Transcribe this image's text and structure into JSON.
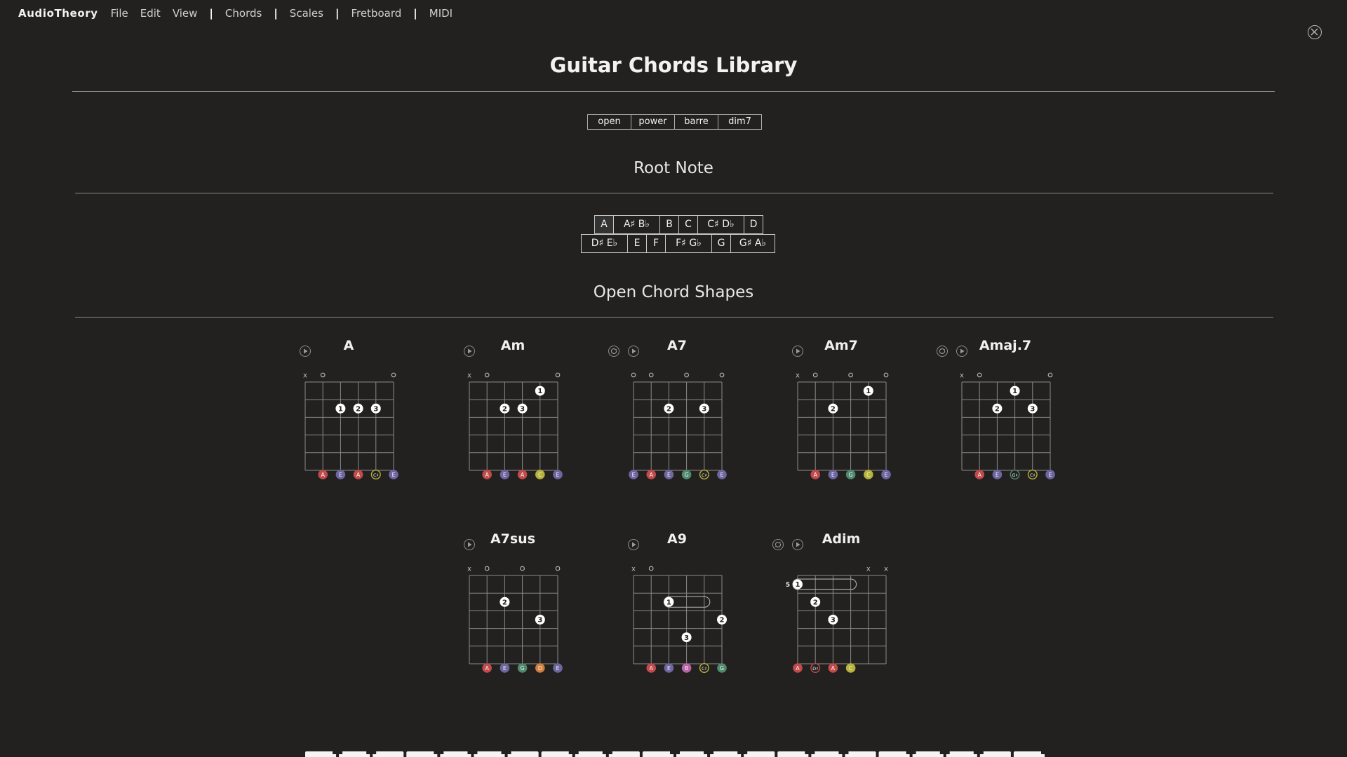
{
  "app": {
    "brand": "AudioTheory",
    "menu": [
      {
        "label": "File",
        "sepBefore": false
      },
      {
        "label": "Edit",
        "sepBefore": false
      },
      {
        "label": "View",
        "sepBefore": false
      },
      {
        "label": "Chords",
        "sepBefore": true
      },
      {
        "label": "Scales",
        "sepBefore": true
      },
      {
        "label": "Fretboard",
        "sepBefore": true
      },
      {
        "label": "MIDI",
        "sepBefore": true
      }
    ]
  },
  "page": {
    "title": "Guitar Chords Library"
  },
  "tabs": [
    {
      "label": "open",
      "active": true
    },
    {
      "label": "power",
      "active": false
    },
    {
      "label": "barre",
      "active": false
    },
    {
      "label": "dim7",
      "active": false
    }
  ],
  "root_note": {
    "heading": "Root Note",
    "row1": [
      "A",
      "A♯ B♭",
      "B",
      "C",
      "C♯ D♭",
      "D"
    ],
    "row2": [
      "D♯ E♭",
      "E",
      "F",
      "F♯ G♭",
      "G",
      "G♯ A♭"
    ]
  },
  "shapes": {
    "heading": "Open Chord Shapes"
  },
  "colors": {
    "A": "#c24a4a",
    "E": "#6e66a0",
    "G": "#4f8a6e",
    "C": "#b6b23a",
    "D": "#d27e3c",
    "B": "#b864a6",
    "background": "#222120",
    "grid": "#8a8a8a"
  },
  "chords": [
    {
      "name": "A",
      "hasLoop": false,
      "markers": [
        "x",
        "o",
        "",
        "",
        "",
        "o"
      ],
      "dots": [
        {
          "s": 2,
          "f": 2,
          "n": "1"
        },
        {
          "s": 3,
          "f": 2,
          "n": "2"
        },
        {
          "s": 4,
          "f": 2,
          "n": "3"
        }
      ],
      "notes": [
        null,
        {
          "t": "A",
          "c": "A"
        },
        {
          "t": "E",
          "c": "E"
        },
        {
          "t": "A",
          "c": "A"
        },
        {
          "t": "C♯",
          "c": "C",
          "o": true
        },
        {
          "t": "E",
          "c": "E"
        }
      ]
    },
    {
      "name": "Am",
      "hasLoop": false,
      "markers": [
        "x",
        "o",
        "",
        "",
        "",
        "o"
      ],
      "dots": [
        {
          "s": 2,
          "f": 2,
          "n": "2"
        },
        {
          "s": 3,
          "f": 2,
          "n": "3"
        },
        {
          "s": 4,
          "f": 1,
          "n": "1"
        }
      ],
      "notes": [
        null,
        {
          "t": "A",
          "c": "A"
        },
        {
          "t": "E",
          "c": "E"
        },
        {
          "t": "A",
          "c": "A"
        },
        {
          "t": "C",
          "c": "C"
        },
        {
          "t": "E",
          "c": "E"
        }
      ]
    },
    {
      "name": "A7",
      "hasLoop": true,
      "markers": [
        "o",
        "o",
        "",
        "o",
        "",
        "o"
      ],
      "dots": [
        {
          "s": 2,
          "f": 2,
          "n": "2"
        },
        {
          "s": 4,
          "f": 2,
          "n": "3"
        }
      ],
      "notes": [
        {
          "t": "E",
          "c": "E"
        },
        {
          "t": "A",
          "c": "A"
        },
        {
          "t": "E",
          "c": "E"
        },
        {
          "t": "G",
          "c": "G"
        },
        {
          "t": "C♯",
          "c": "C",
          "o": true
        },
        {
          "t": "E",
          "c": "E"
        }
      ]
    },
    {
      "name": "Am7",
      "hasLoop": false,
      "markers": [
        "x",
        "o",
        "",
        "o",
        "",
        "o"
      ],
      "dots": [
        {
          "s": 2,
          "f": 2,
          "n": "2"
        },
        {
          "s": 4,
          "f": 1,
          "n": "1"
        }
      ],
      "notes": [
        null,
        {
          "t": "A",
          "c": "A"
        },
        {
          "t": "E",
          "c": "E"
        },
        {
          "t": "G",
          "c": "G"
        },
        {
          "t": "C",
          "c": "C"
        },
        {
          "t": "E",
          "c": "E"
        }
      ]
    },
    {
      "name": "Amaj.7",
      "hasLoop": true,
      "markers": [
        "x",
        "o",
        "",
        "",
        "",
        "o"
      ],
      "dots": [
        {
          "s": 2,
          "f": 2,
          "n": "2"
        },
        {
          "s": 3,
          "f": 1,
          "n": "1"
        },
        {
          "s": 4,
          "f": 2,
          "n": "3"
        }
      ],
      "notes": [
        null,
        {
          "t": "A",
          "c": "A"
        },
        {
          "t": "E",
          "c": "E"
        },
        {
          "t": "G♯",
          "c": "G",
          "o": true
        },
        {
          "t": "C♯",
          "c": "C",
          "o": true
        },
        {
          "t": "E",
          "c": "E"
        }
      ]
    },
    {
      "name": "A7sus",
      "hasLoop": false,
      "markers": [
        "x",
        "o",
        "",
        "o",
        "",
        "o"
      ],
      "dots": [
        {
          "s": 2,
          "f": 2,
          "n": "2"
        },
        {
          "s": 4,
          "f": 3,
          "n": "3"
        }
      ],
      "notes": [
        null,
        {
          "t": "A",
          "c": "A"
        },
        {
          "t": "E",
          "c": "E"
        },
        {
          "t": "G",
          "c": "G"
        },
        {
          "t": "D",
          "c": "D"
        },
        {
          "t": "E",
          "c": "E"
        }
      ]
    },
    {
      "name": "A9",
      "hasLoop": false,
      "markers": [
        "x",
        "o",
        "",
        "",
        "",
        ""
      ],
      "dots": [
        {
          "s": 2,
          "f": 2,
          "n": "1",
          "barTo": 4
        },
        {
          "s": 5,
          "f": 3,
          "n": "2"
        },
        {
          "s": 3,
          "f": 4,
          "n": "3"
        }
      ],
      "notes": [
        null,
        {
          "t": "A",
          "c": "A"
        },
        {
          "t": "E",
          "c": "E"
        },
        {
          "t": "B",
          "c": "B"
        },
        {
          "t": "C♯",
          "c": "C",
          "o": true
        },
        {
          "t": "G",
          "c": "G"
        }
      ]
    },
    {
      "name": "Adim",
      "hasLoop": true,
      "markers": [
        "",
        "",
        "",
        "",
        "x",
        "x"
      ],
      "fretLabel": "5",
      "dots": [
        {
          "s": 0,
          "f": 1,
          "n": "1",
          "barTo": 3
        },
        {
          "s": 1,
          "f": 2,
          "n": "2"
        },
        {
          "s": 2,
          "f": 3,
          "n": "3"
        }
      ],
      "notes": [
        {
          "t": "A",
          "c": "A"
        },
        {
          "t": "D♯",
          "c": "A",
          "o": true
        },
        {
          "t": "A",
          "c": "A"
        },
        {
          "t": "C",
          "c": "C"
        },
        null,
        null
      ]
    }
  ]
}
